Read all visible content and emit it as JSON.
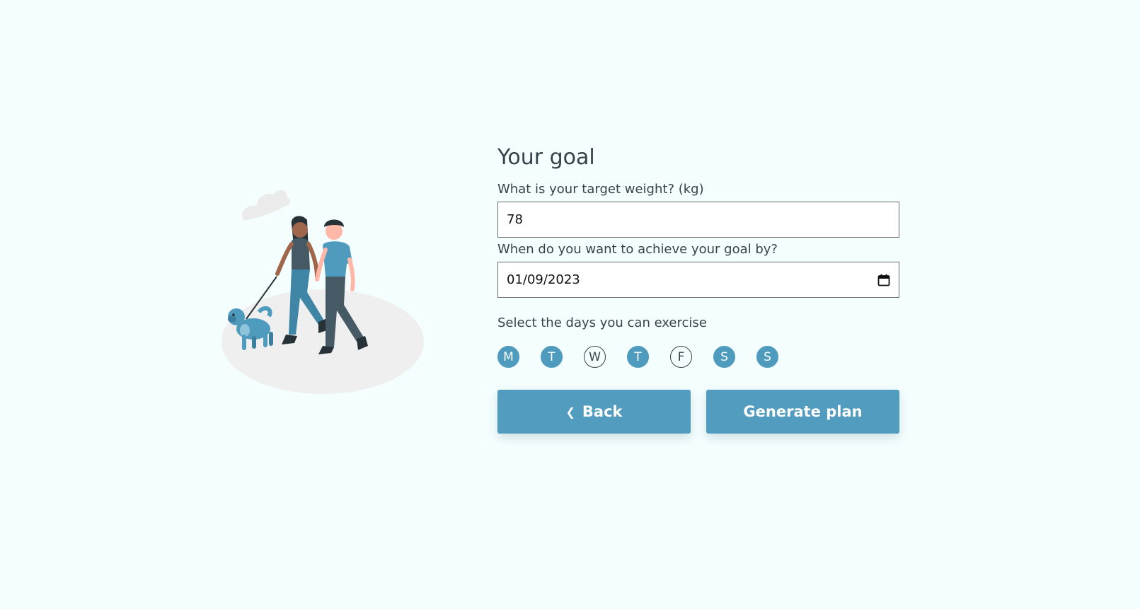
{
  "form": {
    "title": "Your goal",
    "weight_label": "What is your target weight? (kg)",
    "weight_value": "78",
    "date_label": "When do you want to achieve your goal by?",
    "date_value": "01/09/2023",
    "days_label": "Select the days you can exercise",
    "days": [
      {
        "label": "M",
        "selected": true
      },
      {
        "label": "T",
        "selected": true
      },
      {
        "label": "W",
        "selected": false
      },
      {
        "label": "T",
        "selected": true
      },
      {
        "label": "F",
        "selected": false
      },
      {
        "label": "S",
        "selected": true
      },
      {
        "label": "S",
        "selected": true
      }
    ],
    "back_label": "Back",
    "generate_label": "Generate plan"
  },
  "icons": {
    "back": "chevron-left-icon",
    "date": "calendar-icon"
  },
  "colors": {
    "background": "#f4fefe",
    "accent": "#529cbf",
    "text": "#34434b"
  }
}
